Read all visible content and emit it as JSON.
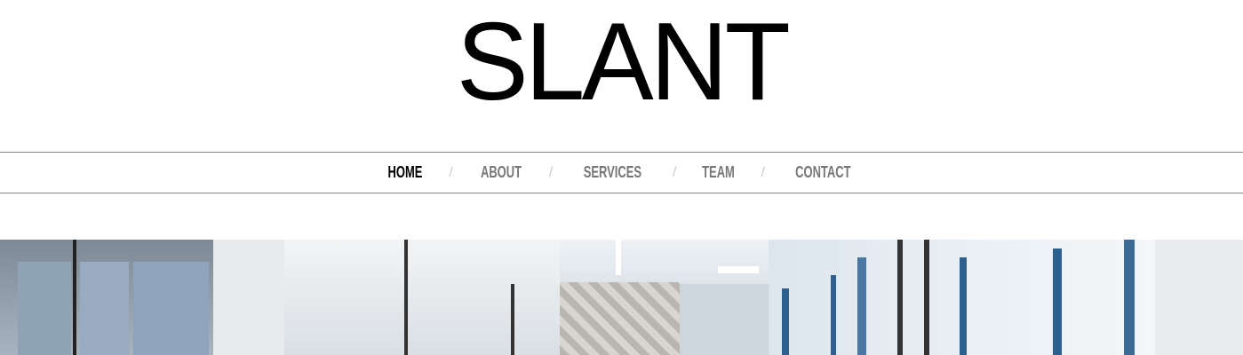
{
  "logo": "SLANT",
  "nav": {
    "items": [
      {
        "label": "HOME",
        "active": true
      },
      {
        "label": "ABOUT"
      },
      {
        "label": "SERVICES"
      },
      {
        "label": "TEAM"
      },
      {
        "label": "CONTACT"
      }
    ],
    "separator": "/"
  },
  "hero": {
    "alt": "office interior"
  }
}
